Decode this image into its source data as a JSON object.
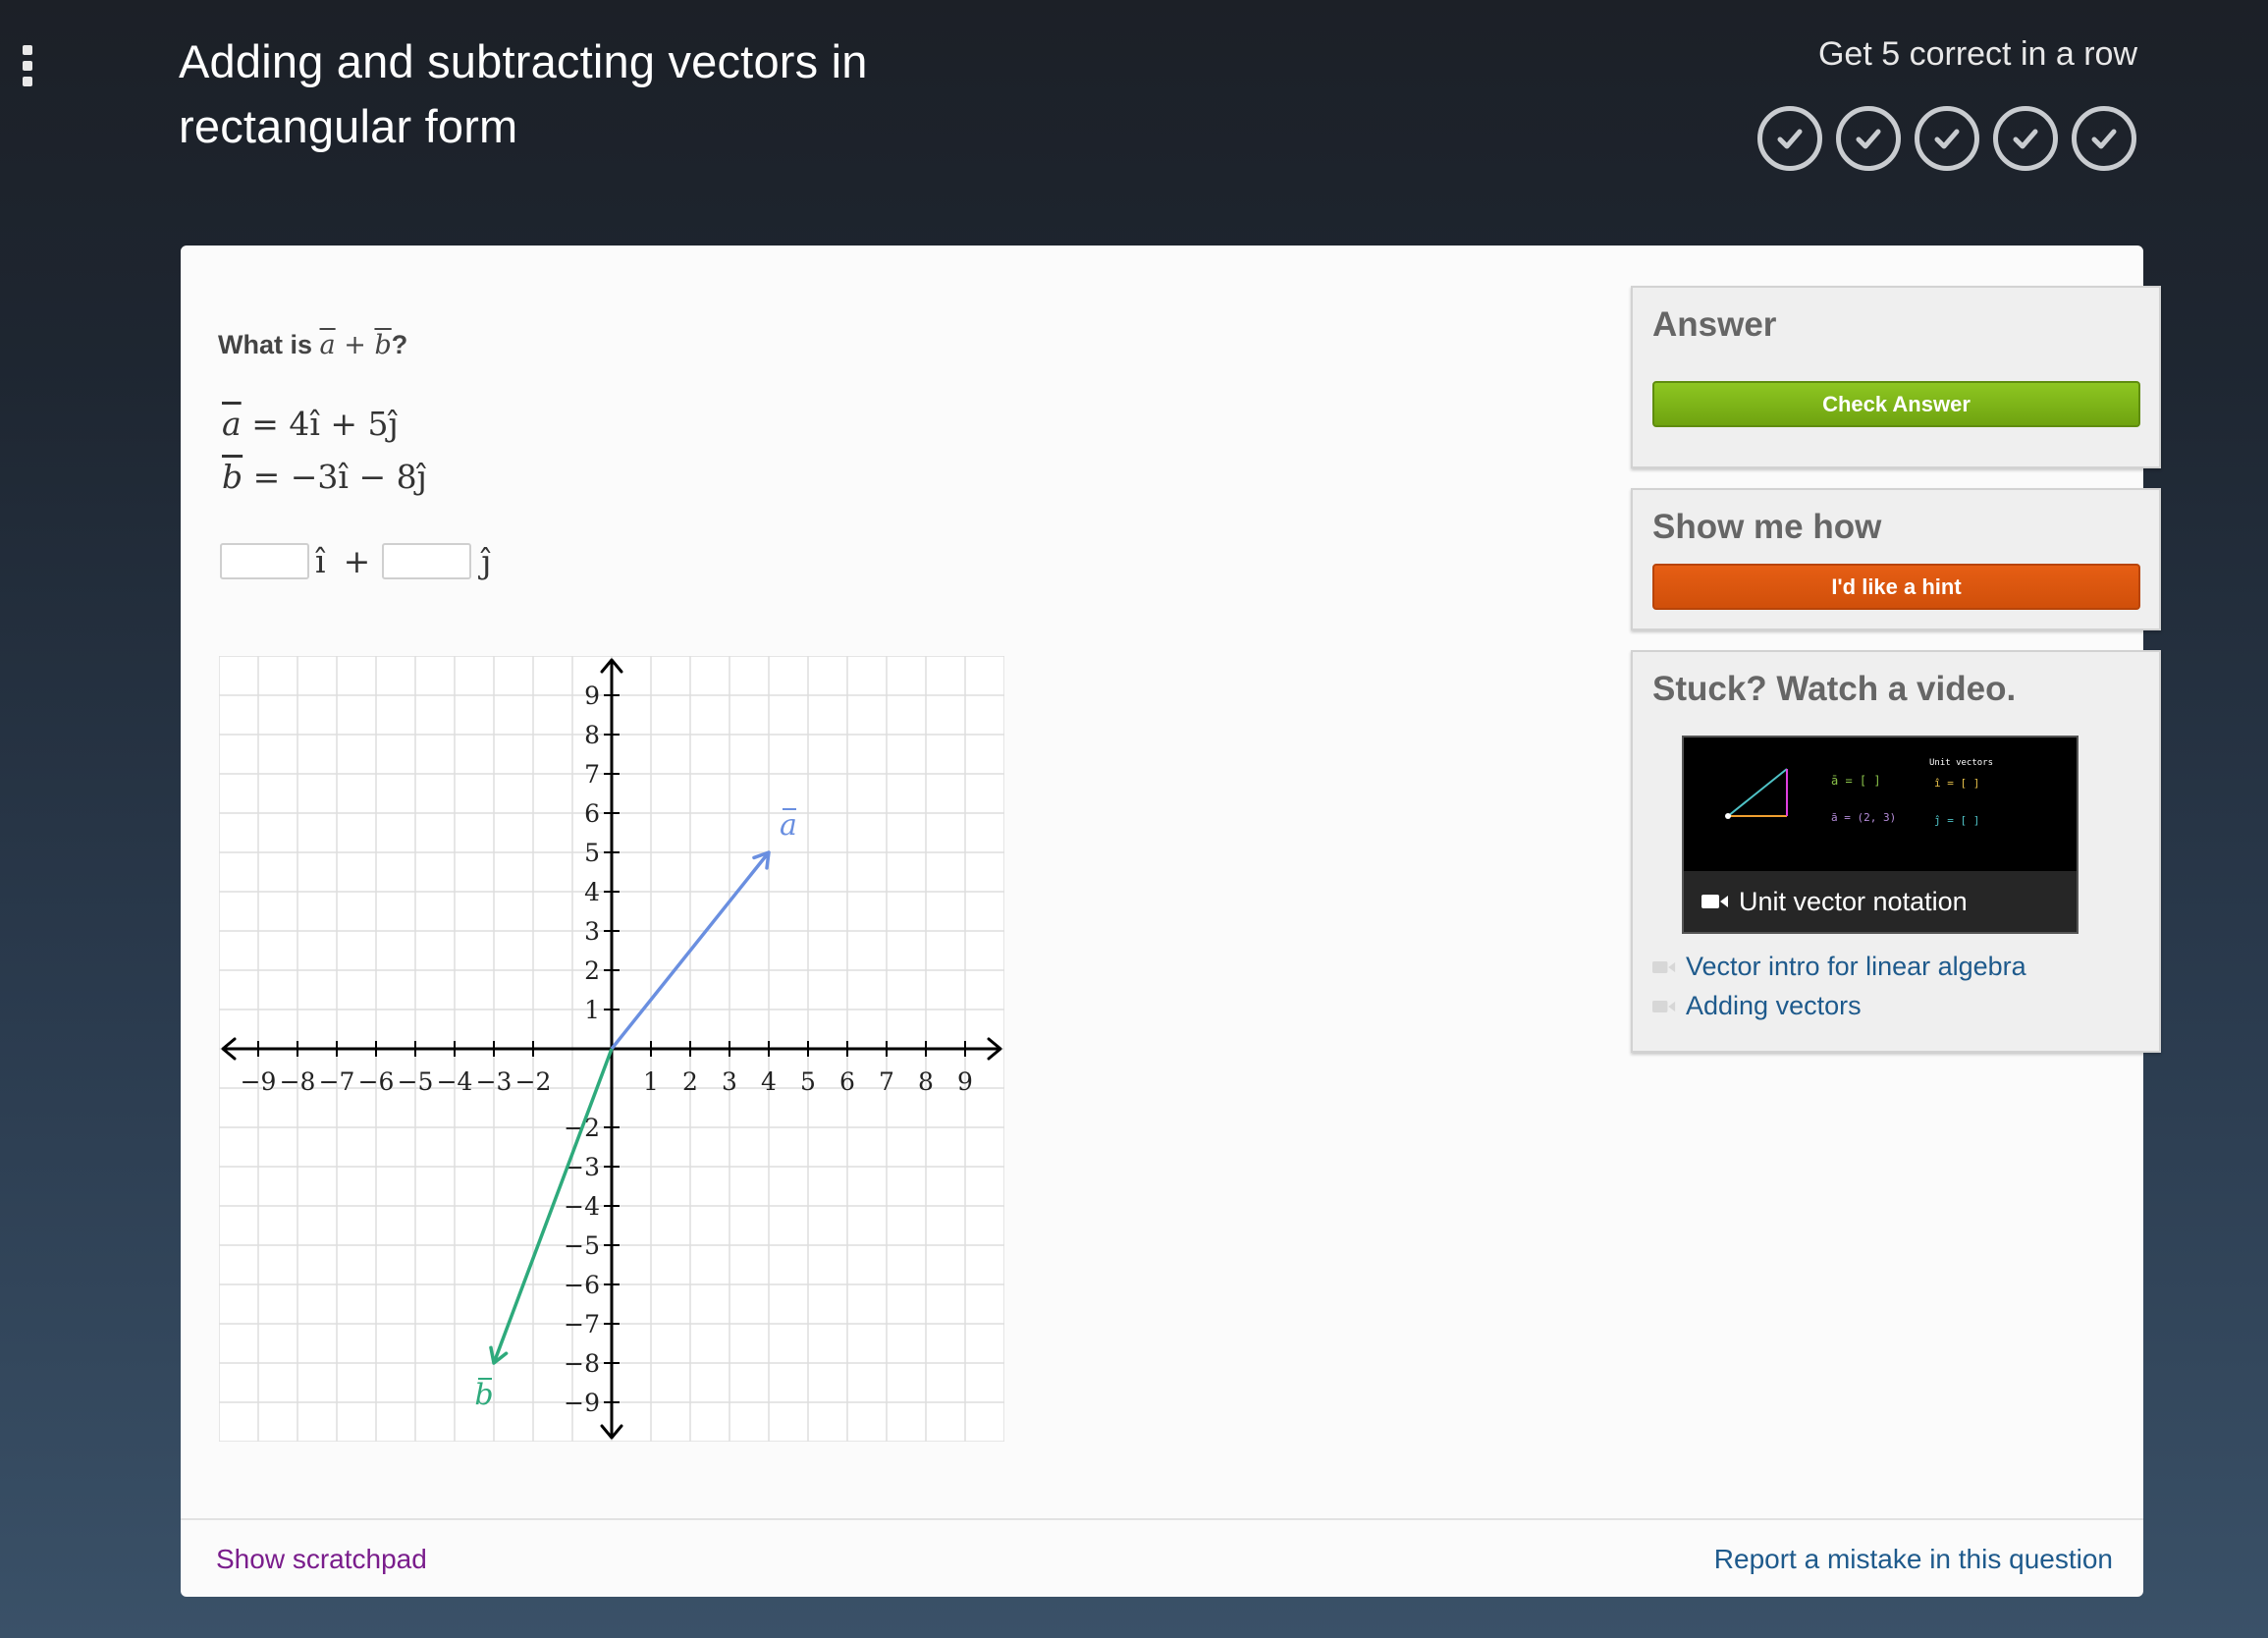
{
  "header": {
    "title": "Adding and subtracting vectors in rectangular form",
    "streak_label": "Get 5 correct in a row",
    "streak_count": 5
  },
  "question": {
    "prompt_prefix": "What is",
    "prompt_a": "a",
    "prompt_plus": "+",
    "prompt_b": "b",
    "prompt_suffix": "?",
    "vec_a_equation": "= 4î + 5ĵ",
    "vec_b_equation": "= −3î − 8ĵ",
    "answer_i_value": "",
    "answer_j_value": "",
    "i_hat": "î",
    "plus": "+",
    "j_hat": "ĵ"
  },
  "chart_data": {
    "type": "scatter",
    "title": "",
    "xlabel": "",
    "ylabel": "",
    "xlim": [
      -10,
      10
    ],
    "ylim": [
      -10,
      10
    ],
    "grid": true,
    "x_ticks": [
      -9,
      -8,
      -7,
      -6,
      -5,
      -4,
      -3,
      -2,
      1,
      2,
      3,
      4,
      5,
      6,
      7,
      8,
      9
    ],
    "y_ticks": [
      9,
      8,
      7,
      6,
      5,
      4,
      3,
      2,
      1,
      -2,
      -3,
      -4,
      -5,
      -6,
      -7,
      -8,
      -9
    ],
    "vectors": [
      {
        "name": "a",
        "from": [
          0,
          0
        ],
        "to": [
          4,
          5
        ],
        "color": "#6a8fe0"
      },
      {
        "name": "b",
        "from": [
          0,
          0
        ],
        "to": [
          -3,
          -8
        ],
        "color": "#2eaa7c"
      }
    ]
  },
  "sidebar": {
    "answer_heading": "Answer",
    "check_button": "Check Answer",
    "hint_heading": "Show me how",
    "hint_button": "I'd like a hint",
    "video_heading": "Stuck? Watch a video.",
    "video_title": "Unit vector notation",
    "related_videos": [
      "Vector intro for linear algebra",
      "Adding vectors"
    ]
  },
  "footer": {
    "scratchpad_link": "Show scratchpad",
    "report_link": "Report a mistake in this question"
  },
  "colors": {
    "check_green": "#7ab317",
    "hint_orange": "#dc5610",
    "link_blue": "#1e5a8c",
    "scratchpad_purple": "#7a1d8c",
    "vector_a": "#6a8fe0",
    "vector_b": "#2eaa7c"
  }
}
